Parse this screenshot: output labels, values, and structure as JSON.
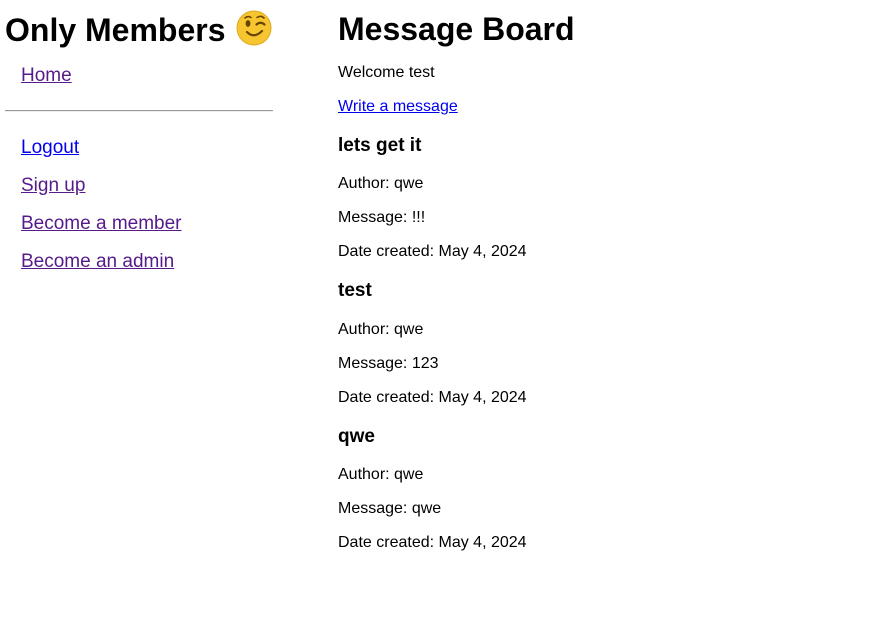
{
  "sidebar": {
    "site_title": "Only Members",
    "emoji": "winking-face-emoji",
    "links": {
      "home": "Home",
      "logout": "Logout",
      "signup": "Sign up",
      "member": "Become a member",
      "admin": "Become an admin"
    }
  },
  "main": {
    "title": "Message Board",
    "welcome": "Welcome test",
    "write_link": "Write a message",
    "messages": [
      {
        "title": "lets get it",
        "author": "Author: qwe",
        "message": "Message: !!!",
        "date": "Date created: May 4, 2024"
      },
      {
        "title": "test",
        "author": "Author: qwe",
        "message": "Message: 123",
        "date": "Date created: May 4, 2024"
      },
      {
        "title": "qwe",
        "author": "Author: qwe",
        "message": "Message: qwe",
        "date": "Date created: May 4, 2024"
      }
    ]
  },
  "colors": {
    "visited_link": "#551a8b",
    "unvisited_link": "#0000ee",
    "emoji_face": "#f7c52f"
  }
}
